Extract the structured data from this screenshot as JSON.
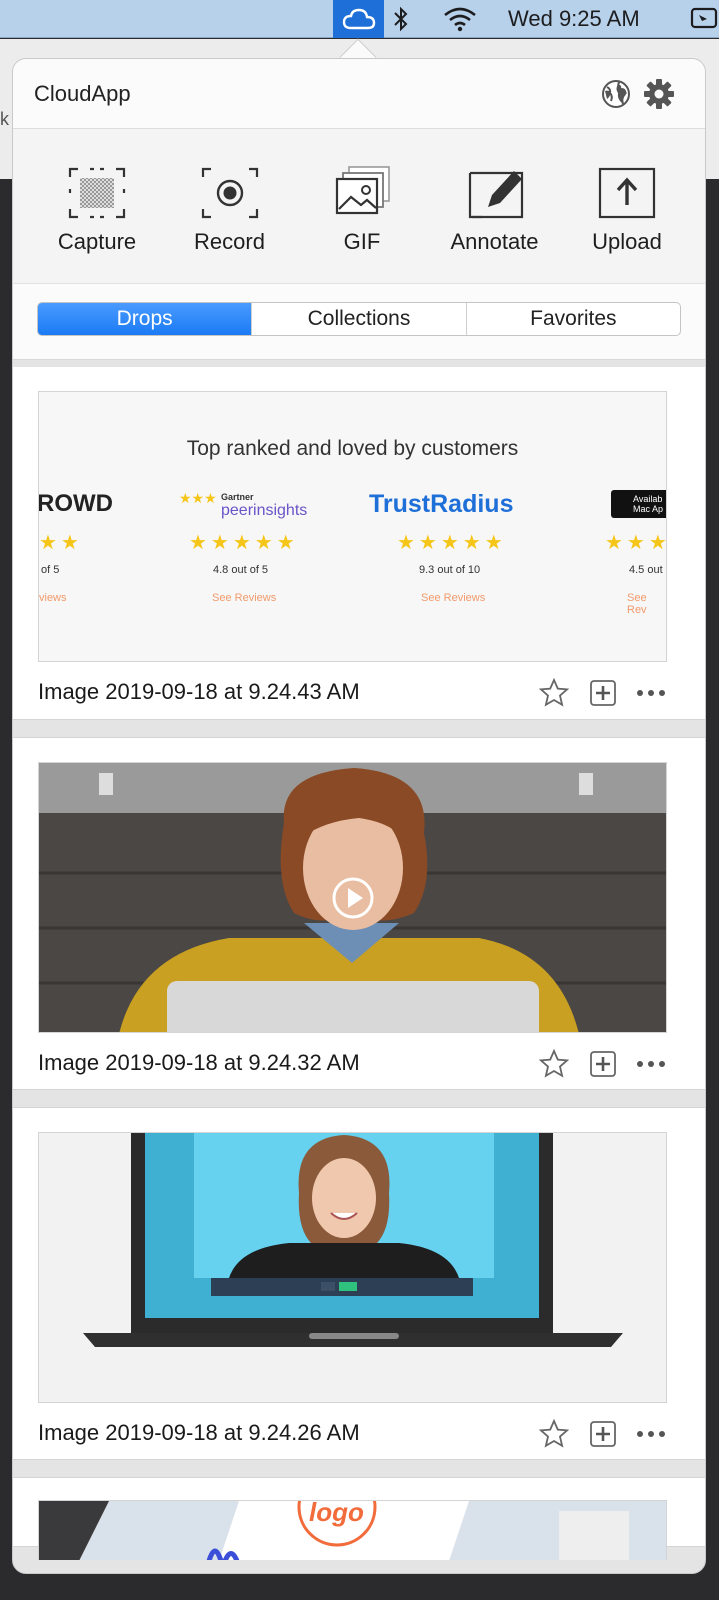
{
  "menubar": {
    "clock": "Wed 9:25 AM",
    "icons": [
      "cloudapp-icon",
      "bluetooth-icon",
      "wifi-icon",
      "screen-mirror-icon"
    ],
    "accent": "#1f6fd8"
  },
  "background_window": {
    "partial_text": "k"
  },
  "popover": {
    "title": "CloudApp",
    "tools": [
      {
        "label": "Capture",
        "icon": "capture-icon"
      },
      {
        "label": "Record",
        "icon": "record-icon"
      },
      {
        "label": "GIF",
        "icon": "gif-icon"
      },
      {
        "label": "Annotate",
        "icon": "annotate-icon"
      },
      {
        "label": "Upload",
        "icon": "upload-icon"
      }
    ],
    "tabs": [
      {
        "label": "Drops",
        "active": true
      },
      {
        "label": "Collections",
        "active": false
      },
      {
        "label": "Favorites",
        "active": false
      }
    ],
    "drops": [
      {
        "title": "Image 2019-09-18 at 9.24.43 AM",
        "thumbnail": {
          "heading": "Top ranked and loved by customers",
          "brands": [
            {
              "name": "ROWD",
              "score": "of 5",
              "link": "views"
            },
            {
              "name": "peerinsights",
              "kicker": "Gartner",
              "score": "4.8 out of 5",
              "link": "See Reviews"
            },
            {
              "name": "TrustRadius",
              "score": "9.3 out of 10",
              "link": "See Reviews"
            },
            {
              "name": "Availab Mac Ap",
              "score": "4.5 out",
              "link": "See Rev"
            }
          ]
        }
      },
      {
        "title": "Image 2019-09-18 at 9.24.32 AM"
      },
      {
        "title": "Image 2019-09-18 at 9.24.26 AM"
      },
      {
        "title": "",
        "thumbnail": {
          "visible_text": "logo"
        }
      }
    ],
    "active_tab_color": "#1b7bf4"
  }
}
